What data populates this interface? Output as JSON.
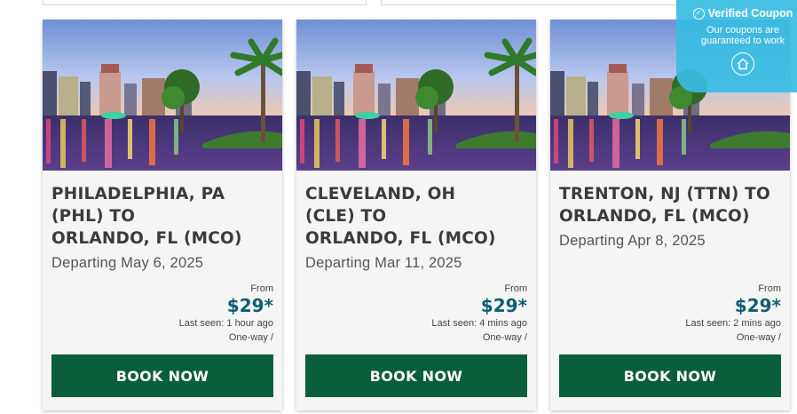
{
  "cards": [
    {
      "title": "PHILADELPHIA, PA\n(PHL) TO\nORLANDO, FL (MCO)",
      "departing": "Departing May 6, 2025",
      "from_label": "From",
      "price": "$29*",
      "last_seen": "Last seen: 1 hour ago",
      "trip_type": "One-way /",
      "button": "BOOK NOW"
    },
    {
      "title": "CLEVELAND, OH\n(CLE) TO\nORLANDO, FL (MCO)",
      "departing": "Departing Mar 11, 2025",
      "from_label": "From",
      "price": "$29*",
      "last_seen": "Last seen: 4 mins ago",
      "trip_type": "One-way /",
      "button": "BOOK NOW"
    },
    {
      "title": "TRENTON, NJ (TTN) TO\nORLANDO, FL (MCO)",
      "departing": "Departing Apr 8, 2025",
      "from_label": "From",
      "price": "$29*",
      "last_seen": "Last seen: 2 mins ago",
      "trip_type": "One-way /",
      "button": "BOOK NOW"
    }
  ],
  "verified_badge": {
    "title": "Verified Coupon",
    "subtitle": "Our coupons are guaranteed to work",
    "icon": "house-icon",
    "check_icon": "check-circle-icon"
  },
  "colors": {
    "price": "#0d5e73",
    "button": "#0b5e3b",
    "badge": "#38bde2"
  }
}
